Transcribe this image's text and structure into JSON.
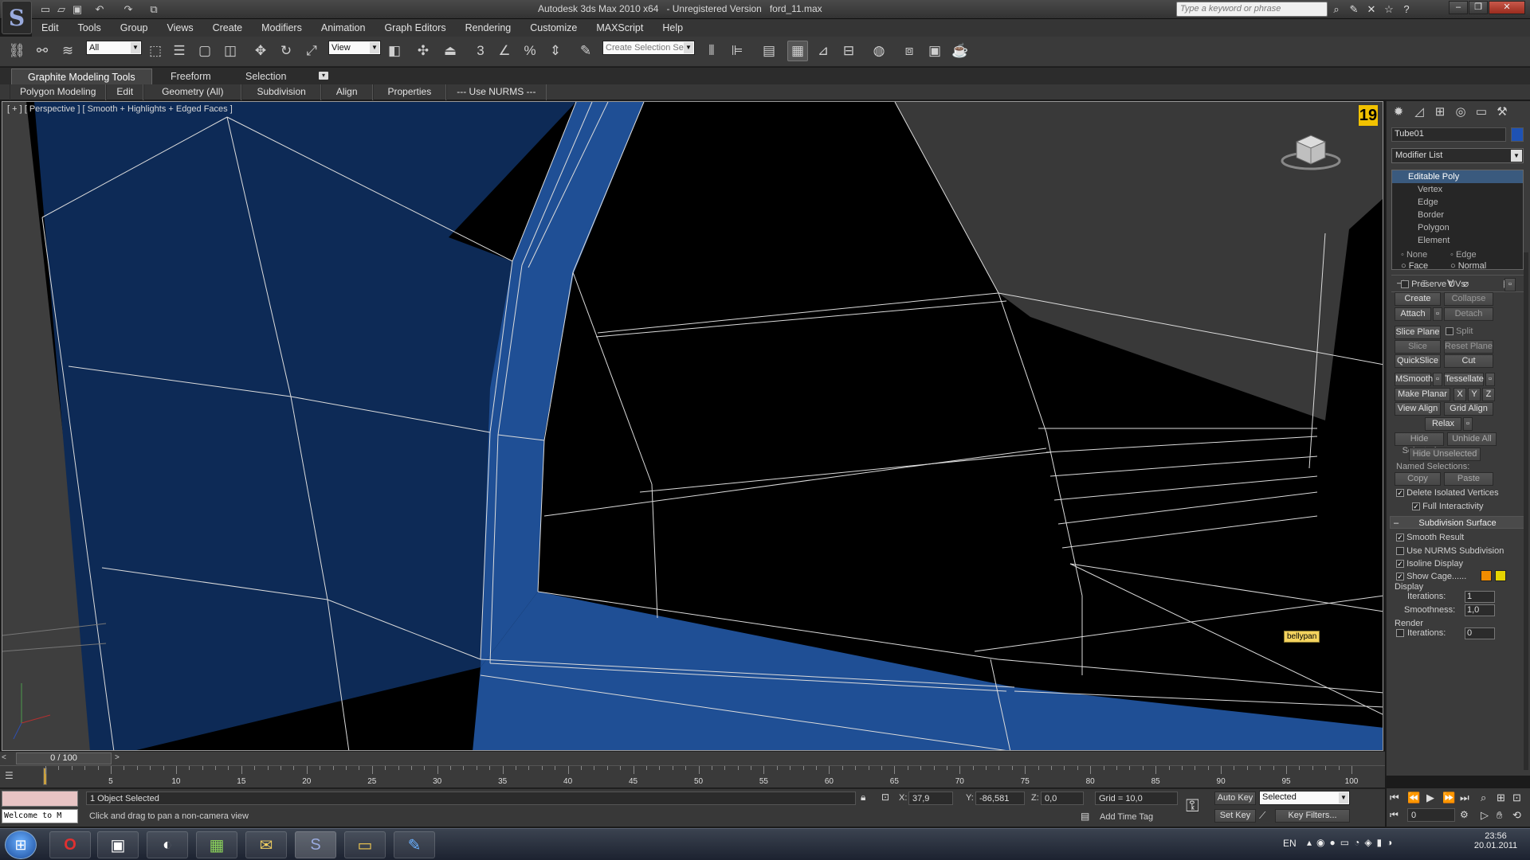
{
  "window": {
    "title_app": "Autodesk 3ds Max  2010 x64",
    "title_version": "- Unregistered Version",
    "title_file": "ford_11.max"
  },
  "search": {
    "placeholder": "Type a keyword or phrase"
  },
  "menu": [
    "Edit",
    "Tools",
    "Group",
    "Views",
    "Create",
    "Modifiers",
    "Animation",
    "Graph Editors",
    "Rendering",
    "Customize",
    "MAXScript",
    "Help"
  ],
  "toolbar": {
    "filter_value": "All",
    "ref_coord_value": "View",
    "named_selection_placeholder": "Create Selection Se"
  },
  "ribbon": {
    "tabs": [
      "Graphite Modeling Tools",
      "Freeform",
      "Selection"
    ],
    "panels": [
      "Polygon Modeling",
      "Edit",
      "Geometry (All)",
      "Subdivision",
      "Align",
      "Properties",
      "--- Use NURMS ---"
    ]
  },
  "viewport": {
    "label": "[ + ] [ Perspective ] [ Smooth + Highlights + Edged Faces ]",
    "badge": "19",
    "tooltip": "bellypan"
  },
  "command_panel": {
    "object_name": "Tube01",
    "modifier_list": "Modifier List",
    "stack": {
      "head": "Editable Poly",
      "items": [
        "Vertex",
        "Edge",
        "Border",
        "Polygon",
        "Element"
      ]
    },
    "radio_row1": [
      "None",
      "Edge"
    ],
    "radio_row2": [
      "Face",
      "Normal"
    ],
    "preserve_uvs": "Preserve UVs",
    "buttons": {
      "create": "Create",
      "collapse": "Collapse",
      "attach": "Attach",
      "detach": "Detach",
      "slice_plane": "Slice Plane",
      "split": "Split",
      "slice": "Slice",
      "reset_plane": "Reset Plane",
      "quickslice": "QuickSlice",
      "cut": "Cut",
      "msmooth": "MSmooth",
      "tessellate": "Tessellate",
      "make_planar": "Make Planar",
      "x": "X",
      "y": "Y",
      "z": "Z",
      "view_align": "View Align",
      "grid_align": "Grid Align",
      "relax": "Relax",
      "hide_selected": "Hide Selected",
      "unhide_all": "Unhide All",
      "hide_unselected": "Hide Unselected",
      "copy": "Copy",
      "paste": "Paste"
    },
    "named_selections": "Named Selections:",
    "delete_isolated": "Delete Isolated Vertices",
    "full_interactivity": "Full Interactivity",
    "subdivision_header": "Subdivision Surface",
    "smooth_result": "Smooth Result",
    "use_nurms": "Use NURMS Subdivision",
    "isoline": "Isoline Display",
    "show_cage": "Show Cage......",
    "cage_colors": [
      "#f28c00",
      "#e6d400"
    ],
    "display_label": "Display",
    "iterations_label": "Iterations:",
    "iterations_value": "1",
    "smoothness_label": "Smoothness:",
    "smoothness_value": "1,0",
    "render_label": "Render",
    "render_iterations_value": "0"
  },
  "timeline": {
    "frame": "0 / 100",
    "ticks": [
      "5",
      "10",
      "15",
      "20",
      "25",
      "30",
      "35",
      "40",
      "45",
      "50",
      "55",
      "60",
      "65",
      "70",
      "75",
      "80",
      "85",
      "90",
      "95",
      "100"
    ]
  },
  "status": {
    "welcome": "Welcome to M",
    "selected": "1 Object Selected",
    "prompt": "Click and drag to pan a non-camera view",
    "x_label": "X:",
    "x_value": "37,9",
    "y_label": "Y:",
    "y_value": "-86,581",
    "z_label": "Z:",
    "z_value": "0,0",
    "grid": "Grid = 10,0",
    "add_time_tag": "Add Time Tag",
    "auto_key": "Auto Key",
    "set_key": "Set Key",
    "key_mode": "Selected",
    "key_filters": "Key Filters...",
    "current_frame": "0"
  },
  "taskbar": {
    "lang": "EN",
    "time": "23:56",
    "date": "20.01.2011"
  }
}
